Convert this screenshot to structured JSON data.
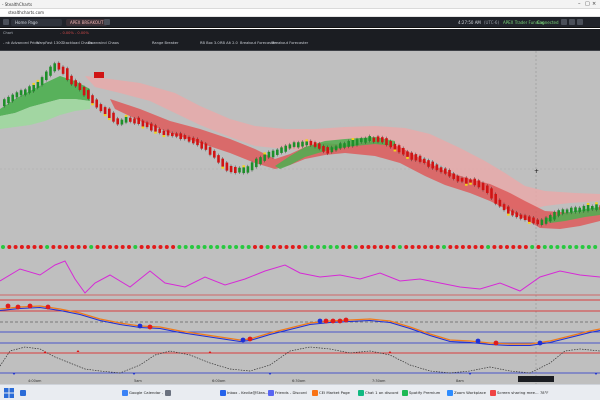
{
  "browser": {
    "tabs": [
      {
        "label": "- StealthCharts"
      },
      {
        "label": "Home Page"
      },
      {
        "label": ""
      }
    ],
    "url": "stealthcharts.com"
  },
  "toolbar": {
    "left_pills": [
      "Home Page",
      ""
    ],
    "active_label": "APEX BREAKOUT",
    "time": "4:27:50 AM",
    "status_small": "(UTC-6)",
    "app_status": "APEX Trader Funding",
    "connection": "Connected"
  },
  "chart_header": {
    "symbol_info": "Chart",
    "ohlc_red": "- 0.00% - 0.00%",
    "studies": [
      "- nk Advanced Price",
      "WarpFast 130C",
      "Stackload Charts",
      "Downwind Chaos",
      "",
      "Range Breaker",
      "RB Box 3.0",
      "RB Alt 2.0",
      "Breakout Forecaster",
      "Breakout Forecaster"
    ]
  },
  "chart": {
    "colors": {
      "bull": "#1e8f2a",
      "bear": "#d01414",
      "marker": "#f2d21c",
      "cloud_bear": "#e07a7a",
      "cloud_bull": "#5cbf5c",
      "band_upper_bear": "#e8a0a0",
      "dot_red": "#e11b1b",
      "dot_green": "#27c93f",
      "osc_magenta": "#d62ad6",
      "osc_blue": "#1e2fd6",
      "osc_orange": "#f07a1a",
      "level_red": "#e01010",
      "level_blue": "#2233cc",
      "dotted": "#333333"
    },
    "crosshair_label": "",
    "x_tick_labels": [
      "4:00am",
      "5am",
      "6:00am",
      "6:30am",
      "7:30am",
      "8am",
      ""
    ]
  },
  "taskbar": {
    "items": [
      {
        "label": "",
        "color": "#2b6cd8"
      },
      {
        "label": "Google Calendar -",
        "color": "#3b82f6"
      },
      {
        "label": "",
        "color": "#6b7280"
      },
      {
        "label": "Inbox - Kevila@Stea...",
        "color": "#2563eb"
      },
      {
        "label": "Friends - Discord",
        "color": "#5865f2"
      },
      {
        "label": "CEI Market Page",
        "color": "#f97316"
      },
      {
        "label": "Chat 1 on discord",
        "color": "#10b981"
      },
      {
        "label": "Spotify Premium",
        "color": "#1db954"
      },
      {
        "label": "Zoom Workplace",
        "color": "#2d8cff"
      },
      {
        "label": "Screen sharing mee...",
        "color": "#ef4444"
      }
    ],
    "weather": "78°F",
    "clock_time": "",
    "clock_date": ""
  }
}
